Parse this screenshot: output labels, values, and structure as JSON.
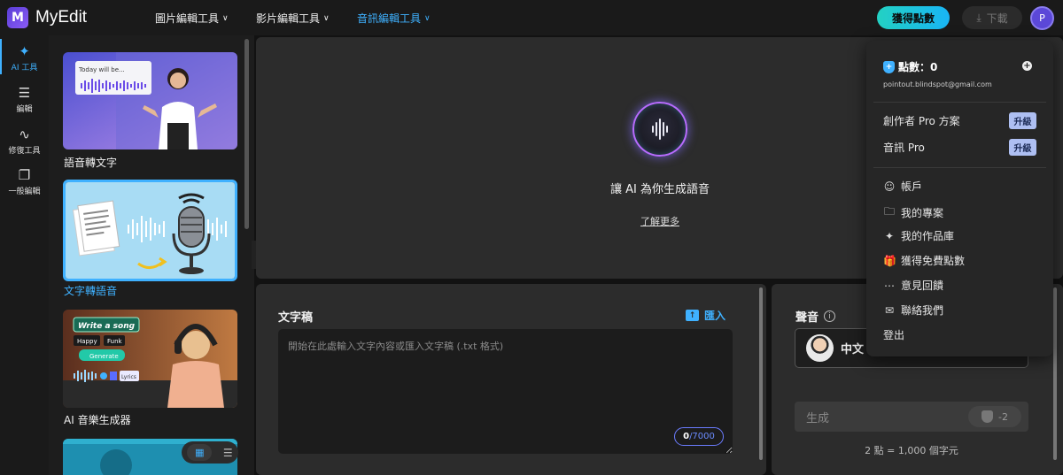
{
  "app": {
    "title": "MyEdit"
  },
  "nav": [
    {
      "label": "圖片編輯工具",
      "active": false
    },
    {
      "label": "影片編輯工具",
      "active": false
    },
    {
      "label": "音訊編輯工具",
      "active": true
    }
  ],
  "header": {
    "get_credits": "獲得點數",
    "download": "下載",
    "avatar_initial": "P"
  },
  "rail": [
    {
      "label": "AI 工具",
      "icon": "magic-wand-icon",
      "active": true
    },
    {
      "label": "編輯",
      "icon": "sliders-icon",
      "active": false
    },
    {
      "label": "修復工具",
      "icon": "waveform-repair-icon",
      "active": false
    },
    {
      "label": "一般編輯",
      "icon": "layers-icon",
      "active": false
    }
  ],
  "tools": [
    {
      "label": "語音轉文字",
      "thumb_text": "Today will be...",
      "active": false
    },
    {
      "label": "文字轉語音",
      "active": true
    },
    {
      "label": "AI 音樂生成器",
      "thumb_text": "Write a song",
      "chips": [
        "Happy",
        "Funk"
      ],
      "generate": "Generate",
      "lyrics": "Lyrics",
      "active": false
    }
  ],
  "preview": {
    "title": "讓 AI 為你生成語音",
    "learn_more": "了解更多"
  },
  "script": {
    "title": "文字稿",
    "import_label": "匯入",
    "placeholder": "開始在此處輸入文字內容或匯入文字稿 (.txt 格式)",
    "count_current": "0",
    "count_max": "/7000"
  },
  "voice": {
    "title": "聲音",
    "language": "中文",
    "generate_label": "生成",
    "generate_cost": "-2",
    "rate_note": "2 點 = 1,000 個字元"
  },
  "menu": {
    "points_label": "點數：0",
    "email": "pointout.blindspot@gmail.com",
    "plans": [
      {
        "label": "創作者 Pro 方案",
        "upgrade": "升級"
      },
      {
        "label": "音訊 Pro",
        "upgrade": "升級"
      }
    ],
    "items": [
      {
        "label": "帳戶",
        "icon": "user-icon"
      },
      {
        "label": "我的專案",
        "icon": "folder-icon"
      },
      {
        "label": "我的作品庫",
        "icon": "sparkle-icon"
      },
      {
        "label": "獲得免費點數",
        "icon": "gift-icon"
      },
      {
        "label": "意見回饋",
        "icon": "feedback-icon"
      },
      {
        "label": "聯絡我們",
        "icon": "mail-icon"
      },
      {
        "label": "登出",
        "icon": ""
      }
    ]
  },
  "colors": {
    "accent": "#3fb1ff",
    "cta_start": "#23d1c3",
    "cta_end": "#19b5f5",
    "upgrade": "#aebff2",
    "orb_ring": "#b86cff"
  }
}
